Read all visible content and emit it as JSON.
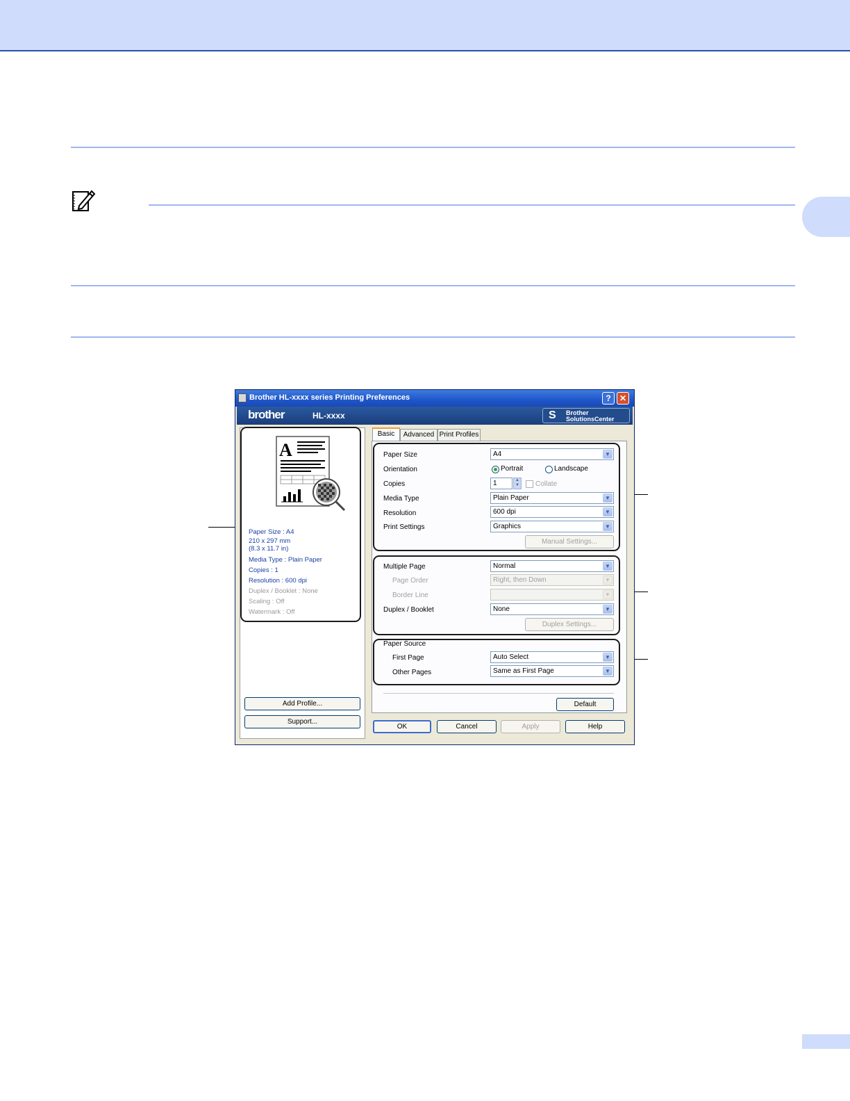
{
  "dialog": {
    "title": "Brother HL-xxxx series Printing Preferences",
    "brand_logo": "brother",
    "model": "HL-xxxx",
    "solutions_center_line1": "Brother",
    "solutions_center_line2": "SolutionsCenter",
    "help_btn": "?",
    "close_btn": "✕",
    "tabs": [
      "Basic",
      "Advanced",
      "Print Profiles"
    ],
    "paper_size_label": "Paper Size",
    "paper_size_value": "A4",
    "orientation_label": "Orientation",
    "orientation_portrait": "Portrait",
    "orientation_landscape": "Landscape",
    "copies_label": "Copies",
    "copies_value": "1",
    "collate_label": "Collate",
    "media_type_label": "Media Type",
    "media_type_value": "Plain Paper",
    "resolution_label": "Resolution",
    "resolution_value": "600 dpi",
    "print_settings_label": "Print Settings",
    "print_settings_value": "Graphics",
    "manual_settings_btn": "Manual Settings...",
    "multiple_page_label": "Multiple Page",
    "multiple_page_value": "Normal",
    "page_order_label": "Page Order",
    "page_order_value": "Right, then Down",
    "border_line_label": "Border Line",
    "duplex_label": "Duplex / Booklet",
    "duplex_value": "None",
    "duplex_settings_btn": "Duplex Settings...",
    "paper_source_label": "Paper Source",
    "first_page_label": "First Page",
    "first_page_value": "Auto Select",
    "other_pages_label": "Other Pages",
    "other_pages_value": "Same as First Page",
    "default_btn": "Default",
    "add_profile_btn": "Add Profile...",
    "support_btn": "Support...",
    "ok_btn": "OK",
    "cancel_btn": "Cancel",
    "apply_btn": "Apply",
    "help_bottom_btn": "Help"
  },
  "summary": {
    "paper_size": "Paper Size : A4",
    "paper_mm": "210 x 297 mm",
    "paper_in": "(8.3 x 11.7 in)",
    "media_type": "Media Type : Plain Paper",
    "copies": "Copies : 1",
    "resolution": "Resolution : 600 dpi",
    "duplex": "Duplex / Booklet : None",
    "scaling": "Scaling : Off",
    "watermark": "Watermark : Off"
  },
  "preview_letter": "A",
  "colors": {
    "band": "#cfdcfb",
    "rule": "#9fb6ef",
    "summary_text": "#1b3fa6"
  }
}
